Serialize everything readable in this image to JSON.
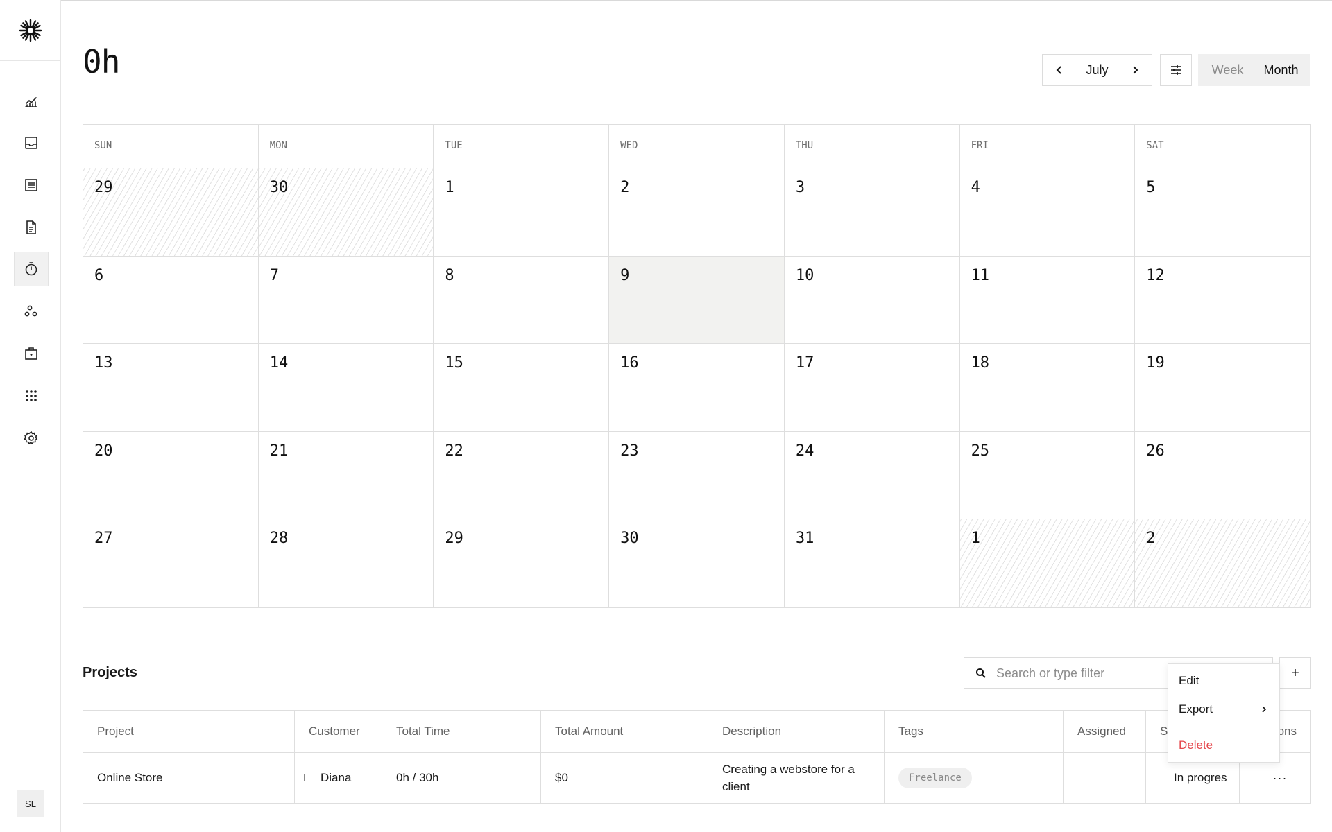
{
  "page": {
    "title": "0h"
  },
  "sidebar": {
    "items": [
      {
        "icon": "chart-line-icon",
        "name": "overview"
      },
      {
        "icon": "inbox-icon",
        "name": "inbox"
      },
      {
        "icon": "list-icon",
        "name": "transactions"
      },
      {
        "icon": "document-icon",
        "name": "invoices"
      },
      {
        "icon": "stopwatch-icon",
        "name": "tracker",
        "active": true
      },
      {
        "icon": "people-icon",
        "name": "customers"
      },
      {
        "icon": "briefcase-icon",
        "name": "vault"
      },
      {
        "icon": "apps-grid-icon",
        "name": "apps"
      },
      {
        "icon": "gear-icon",
        "name": "settings"
      }
    ],
    "avatar_initials": "SL"
  },
  "header": {
    "month": "July",
    "views": [
      "Week",
      "Month"
    ],
    "selected_view": "Month"
  },
  "calendar": {
    "weekdays": [
      "SUN",
      "MON",
      "TUE",
      "WED",
      "THU",
      "FRI",
      "SAT"
    ],
    "days": [
      {
        "d": "29",
        "out": true
      },
      {
        "d": "30",
        "out": true
      },
      {
        "d": "1"
      },
      {
        "d": "2"
      },
      {
        "d": "3"
      },
      {
        "d": "4"
      },
      {
        "d": "5"
      },
      {
        "d": "6"
      },
      {
        "d": "7"
      },
      {
        "d": "8"
      },
      {
        "d": "9",
        "today": true
      },
      {
        "d": "10"
      },
      {
        "d": "11"
      },
      {
        "d": "12"
      },
      {
        "d": "13"
      },
      {
        "d": "14"
      },
      {
        "d": "15"
      },
      {
        "d": "16"
      },
      {
        "d": "17"
      },
      {
        "d": "18"
      },
      {
        "d": "19"
      },
      {
        "d": "20"
      },
      {
        "d": "21"
      },
      {
        "d": "22"
      },
      {
        "d": "23"
      },
      {
        "d": "24"
      },
      {
        "d": "25"
      },
      {
        "d": "26"
      },
      {
        "d": "27"
      },
      {
        "d": "28"
      },
      {
        "d": "29"
      },
      {
        "d": "30"
      },
      {
        "d": "31"
      },
      {
        "d": "1",
        "out": true
      },
      {
        "d": "2",
        "out": true
      }
    ]
  },
  "projects": {
    "title": "Projects",
    "search_placeholder": "Search or type filter",
    "add_label": "+",
    "columns": {
      "project": "Project",
      "customer": "Customer",
      "total_time": "Total Time",
      "total_amount": "Total Amount",
      "description": "Description",
      "tags": "Tags",
      "assigned": "Assigned",
      "status": "S",
      "actions": "ons"
    },
    "rows": [
      {
        "project": "Online Store",
        "customer": "Diana",
        "total_time": "0h / 30h",
        "total_amount": "$0",
        "description": "Creating a webstore for a client",
        "tag": "Freelance",
        "assigned": "",
        "status": "In progres",
        "status_color": "#f1c40f",
        "actions": "···"
      }
    ]
  },
  "menu": {
    "edit": "Edit",
    "export": "Export",
    "delete": "Delete"
  },
  "colors": {
    "danger": "#e5484d",
    "status_in_progress": "#f1c40f"
  }
}
